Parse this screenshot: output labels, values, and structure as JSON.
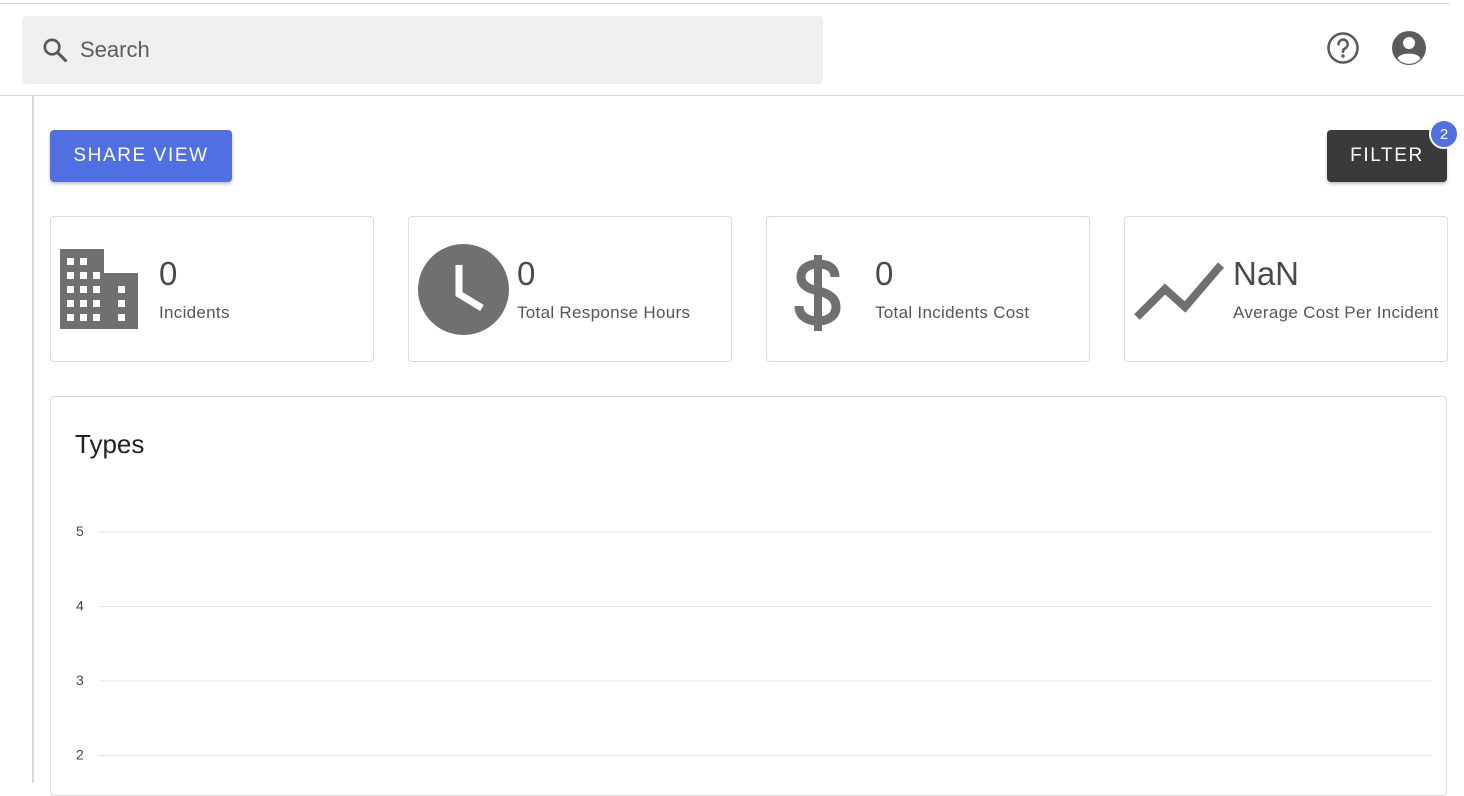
{
  "search": {
    "placeholder": "Search"
  },
  "appbar": {
    "icons": [
      "moon-icon",
      "help-icon",
      "account-icon"
    ]
  },
  "actions": {
    "share_label": "SHARE VIEW",
    "filter_label": "FILTER",
    "filter_badge": "2"
  },
  "colors": {
    "primary": "#4f6fe3",
    "dark_button": "#3a3a3a",
    "icon_gray": "#707070"
  },
  "stats": [
    {
      "icon": "building-icon",
      "value": "0",
      "label": "Incidents"
    },
    {
      "icon": "clock-icon",
      "value": "0",
      "label": "Total Response Hours"
    },
    {
      "icon": "dollar-icon",
      "value": "0",
      "label": "Total Incidents Cost"
    },
    {
      "icon": "trending-up-icon",
      "value": "NaN",
      "label": "Average Cost Per Incident"
    }
  ],
  "types_panel": {
    "title": "Types"
  },
  "chart_data": {
    "type": "bar",
    "title": "Types",
    "categories": [],
    "values": [],
    "xlabel": "",
    "ylabel": "",
    "y_ticks": [
      "5",
      "4",
      "3",
      "2"
    ],
    "grid": true
  }
}
